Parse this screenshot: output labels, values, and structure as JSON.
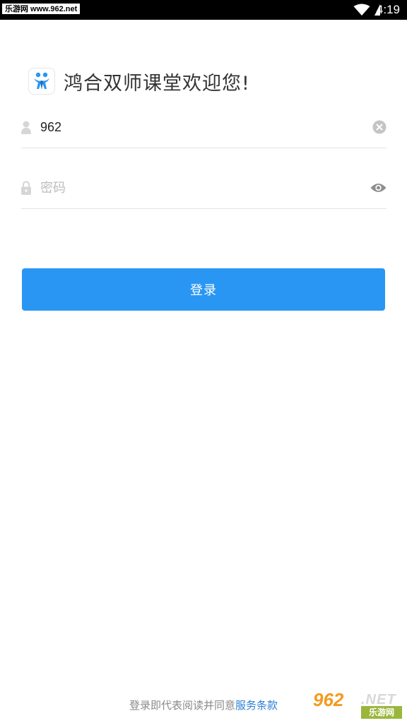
{
  "status_bar": {
    "watermark_text": "乐游网 www.962.net",
    "time": "4:19"
  },
  "header": {
    "logo_icon": "two-figures-logo-icon",
    "title": "鸿合双师课堂欢迎您!"
  },
  "login_form": {
    "username": {
      "icon": "user-icon",
      "value": "962",
      "clear_icon": "clear-circle-icon"
    },
    "password": {
      "icon": "lock-icon",
      "placeholder": "密码",
      "toggle_icon": "eye-icon"
    },
    "submit_label": "登录"
  },
  "footer": {
    "agreement_prefix": "登录即代表阅读并同意",
    "agreement_link": "服务条款"
  },
  "corner_watermark": {
    "number": "962",
    "suffix": ".NET",
    "sub_text": "乐游网"
  },
  "colors": {
    "accent": "#2a96f3",
    "link": "#2a7fd4",
    "status_bar": "#000000"
  }
}
